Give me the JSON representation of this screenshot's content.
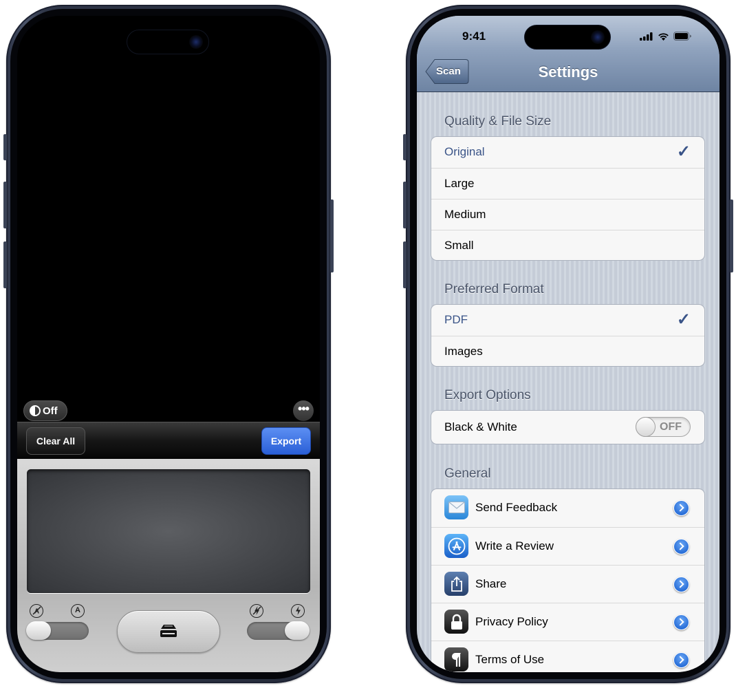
{
  "scanner": {
    "filter_toggle": "Off",
    "more_glyph": "•••",
    "clear_label": "Clear All",
    "export_label": "Export",
    "auto_capture_icons": [
      "auto-off-icon",
      "auto-icon"
    ],
    "flash_icons": [
      "flash-off-icon",
      "flash-icon"
    ],
    "auto_letter": "A",
    "shutter_icon": "scanner-icon"
  },
  "status_bar": {
    "time": "9:41",
    "icons": [
      "cellular-signal-icon",
      "wifi-icon",
      "battery-icon"
    ]
  },
  "settings": {
    "nav": {
      "title": "Settings",
      "back_label": "Scan"
    },
    "quality": {
      "header": "Quality & File Size",
      "items": [
        {
          "label": "Original",
          "selected": true
        },
        {
          "label": "Large",
          "selected": false
        },
        {
          "label": "Medium",
          "selected": false
        },
        {
          "label": "Small",
          "selected": false
        }
      ]
    },
    "format": {
      "header": "Preferred Format",
      "items": [
        {
          "label": "PDF",
          "selected": true
        },
        {
          "label": "Images",
          "selected": false
        }
      ]
    },
    "export_options": {
      "header": "Export Options",
      "black_white_label": "Black & White",
      "black_white_state": "OFF"
    },
    "general": {
      "header": "General",
      "items": [
        {
          "label": "Send Feedback",
          "icon": "mail-icon"
        },
        {
          "label": "Write a Review",
          "icon": "app-store-icon"
        },
        {
          "label": "Share",
          "icon": "share-icon"
        },
        {
          "label": "Privacy Policy",
          "icon": "lock-icon"
        },
        {
          "label": "Terms of Use",
          "icon": "paragraph-icon"
        }
      ]
    },
    "check_glyph": "✓"
  },
  "colors": {
    "accent_blue": "#3a5488",
    "export_blue": "#2a5fd6",
    "disclosure_blue": "#2a6fd8"
  }
}
